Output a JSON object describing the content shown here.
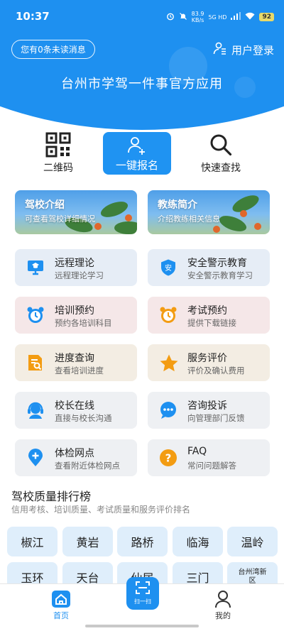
{
  "status_bar": {
    "time": "10:37",
    "net_speed": "83.9",
    "net_unit": "KB/s",
    "signal": "5G HD",
    "battery": "92"
  },
  "header": {
    "unread_label": "您有0条未读消息",
    "login_label": "用户登录",
    "title": "台州市学驾一件事官方应用"
  },
  "quick_actions": [
    {
      "label": "二维码",
      "icon": "qr-code-icon"
    },
    {
      "label": "一键报名",
      "icon": "add-user-icon"
    },
    {
      "label": "快速查找",
      "icon": "search-icon"
    }
  ],
  "banners": [
    {
      "title": "驾校介绍",
      "subtitle": "可查看驾校详细情况"
    },
    {
      "title": "教练简介",
      "subtitle": "介绍教练相关信息"
    }
  ],
  "services": [
    {
      "title": "远程理论",
      "subtitle": "远程理论学习",
      "icon": "monitor-icon"
    },
    {
      "title": "安全警示教育",
      "subtitle": "安全警示教育学习",
      "icon": "shield-icon",
      "badge": "安"
    },
    {
      "title": "培训预约",
      "subtitle": "预约各培训科目",
      "icon": "alarm-clock-icon"
    },
    {
      "title": "考试预约",
      "subtitle": "提供下载链接",
      "icon": "alarm-clock-icon"
    },
    {
      "title": "进度查询",
      "subtitle": "查看培训进度",
      "icon": "document-search-icon"
    },
    {
      "title": "服务评价",
      "subtitle": "评价及确认费用",
      "icon": "star-icon"
    },
    {
      "title": "校长在线",
      "subtitle": "直接与校长沟通",
      "icon": "headset-icon"
    },
    {
      "title": "咨询投诉",
      "subtitle": "向管理部门反馈",
      "icon": "chat-icon"
    },
    {
      "title": "体检网点",
      "subtitle": "查看附近体检网点",
      "icon": "location-plus-icon"
    },
    {
      "title": "FAQ",
      "subtitle": "常问问题解答",
      "icon": "question-icon",
      "badge": "?"
    }
  ],
  "ranking": {
    "title": "驾校质量排行榜",
    "subtitle": "信用考核、培训质量、考试质量和服务评价排名",
    "regions": [
      "椒江",
      "黄岩",
      "路桥",
      "临海",
      "温岭",
      "玉环",
      "天台",
      "仙居",
      "三门",
      "台州湾新区"
    ]
  },
  "bottom_nav": {
    "home_label": "首页",
    "scan_label": "扫一扫",
    "me_label": "我的"
  },
  "colors": {
    "primary": "#1e90f0",
    "orange": "#f39c12",
    "region_bg": "#dfeefb"
  }
}
